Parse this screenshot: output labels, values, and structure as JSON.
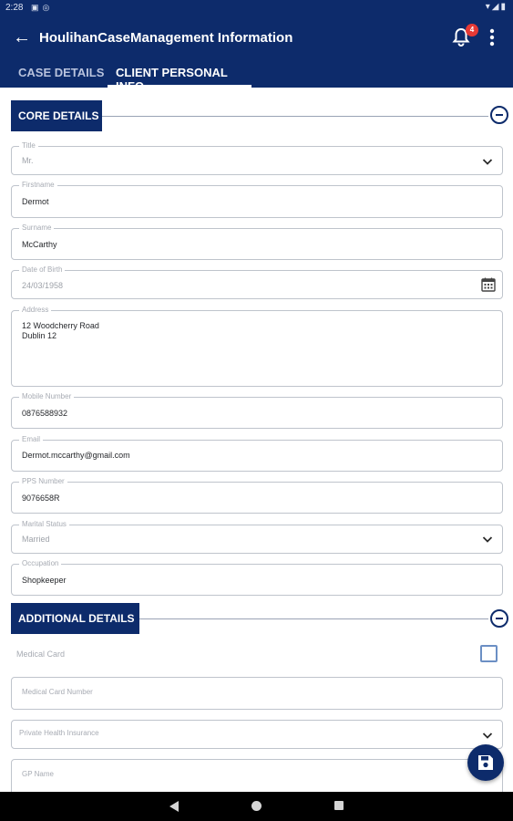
{
  "status_bar": {
    "time": "2:28",
    "left_icons": [
      "sim-icon",
      "vpn-icon"
    ],
    "right_icons": [
      "wifi-icon",
      "signal-icon",
      "battery-icon"
    ]
  },
  "app_bar": {
    "back_icon": "arrow-left-icon",
    "title": "HoulihanCaseManagement Information",
    "notification_count": "4",
    "more_icon": "more-vert-icon"
  },
  "tabs": [
    {
      "label": "CASE DETAILS",
      "active": false
    },
    {
      "label": "CLIENT PERSONAL INFO",
      "active": true
    }
  ],
  "core_details": {
    "heading": "CORE DETAILS",
    "fields": {
      "title": {
        "label": "Title",
        "value": "Mr."
      },
      "firstname": {
        "label": "Firstname",
        "value": "Dermot"
      },
      "surname": {
        "label": "Surname",
        "value": "McCarthy"
      },
      "dob": {
        "label": "Date of Birth",
        "value": "24/03/1958"
      },
      "address": {
        "label": "Address",
        "value": "12 Woodcherry Road\nDublin 12"
      },
      "mobile": {
        "label": "Mobile Number",
        "value": "0876588932"
      },
      "email": {
        "label": "Email",
        "value": "Dermot.mccarthy@gmail.com"
      },
      "pps": {
        "label": "PPS Number",
        "value": "9076658R"
      },
      "marital_status": {
        "label": "Marital Status",
        "value": "Married"
      },
      "occupation": {
        "label": "Occupation",
        "value": "Shopkeeper"
      }
    }
  },
  "additional_details": {
    "heading": "ADDITIONAL DETAILS",
    "medical_card": {
      "label": "Medical Card",
      "checked": false
    },
    "medical_card_number": {
      "placeholder": "Medical Card Number"
    },
    "private_health_insurance": {
      "placeholder": "Private Health Insurance"
    },
    "gp_name": {
      "placeholder": "GP Name"
    }
  },
  "fab": {
    "icon": "save-icon"
  },
  "nav_bar": {
    "icons": [
      "nav-back-icon",
      "nav-home-icon",
      "nav-recents-icon"
    ]
  },
  "colors": {
    "primary": "#0d2b6b",
    "badge": "#e53935",
    "checkbox": "#6b8fc4"
  }
}
